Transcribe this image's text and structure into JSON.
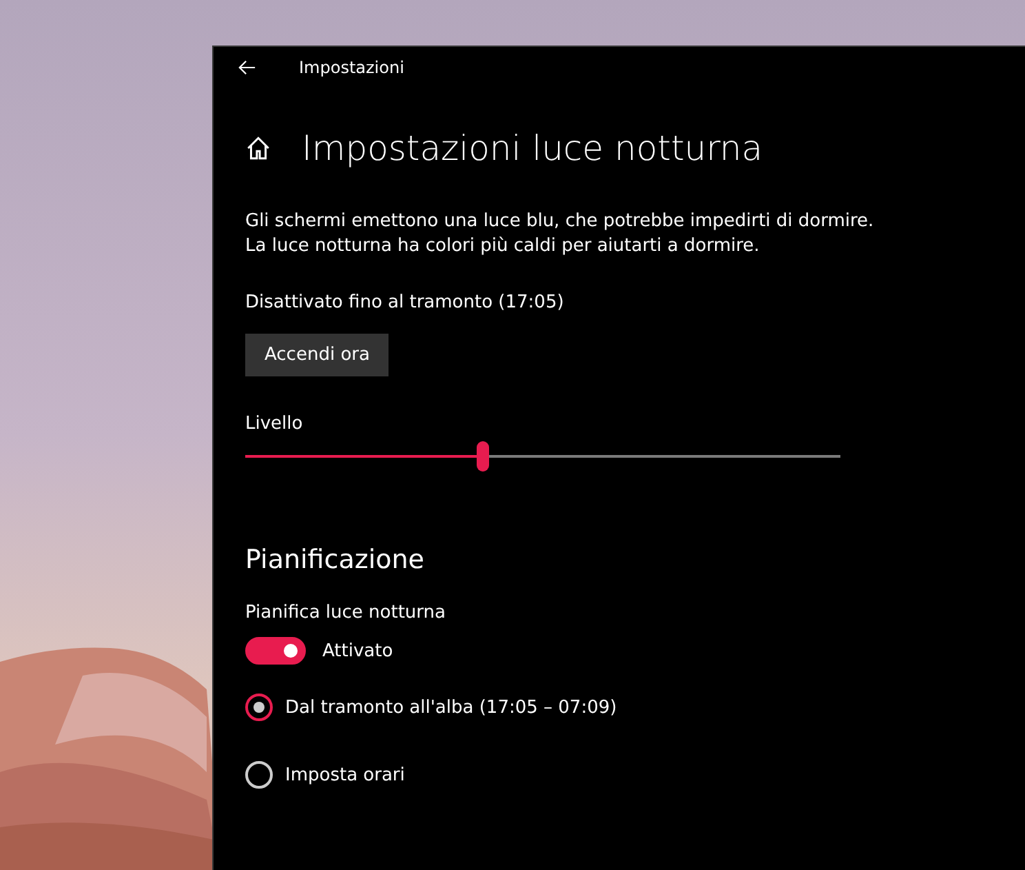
{
  "window": {
    "title": "Impostazioni"
  },
  "page": {
    "heading": "Impostazioni luce notturna"
  },
  "description": [
    "Gli schermi emettono una luce blu, che potrebbe impedirti di dormire.",
    "La luce notturna ha colori più caldi per aiutarti a dormire."
  ],
  "status": "Disattivato fino al tramonto (17:05)",
  "button": "Accendi ora",
  "slider": {
    "label": "Livello",
    "level": 0.4
  },
  "schedule": {
    "title": "Pianificazione",
    "toggle_label": "Pianifica luce notturna",
    "on": true,
    "state_text": "Attivato",
    "options": [
      {
        "label": "Dal tramonto all'alba (17:05 – 07:09)",
        "selected": true
      },
      {
        "label": "Imposta orari",
        "selected": false
      }
    ]
  }
}
